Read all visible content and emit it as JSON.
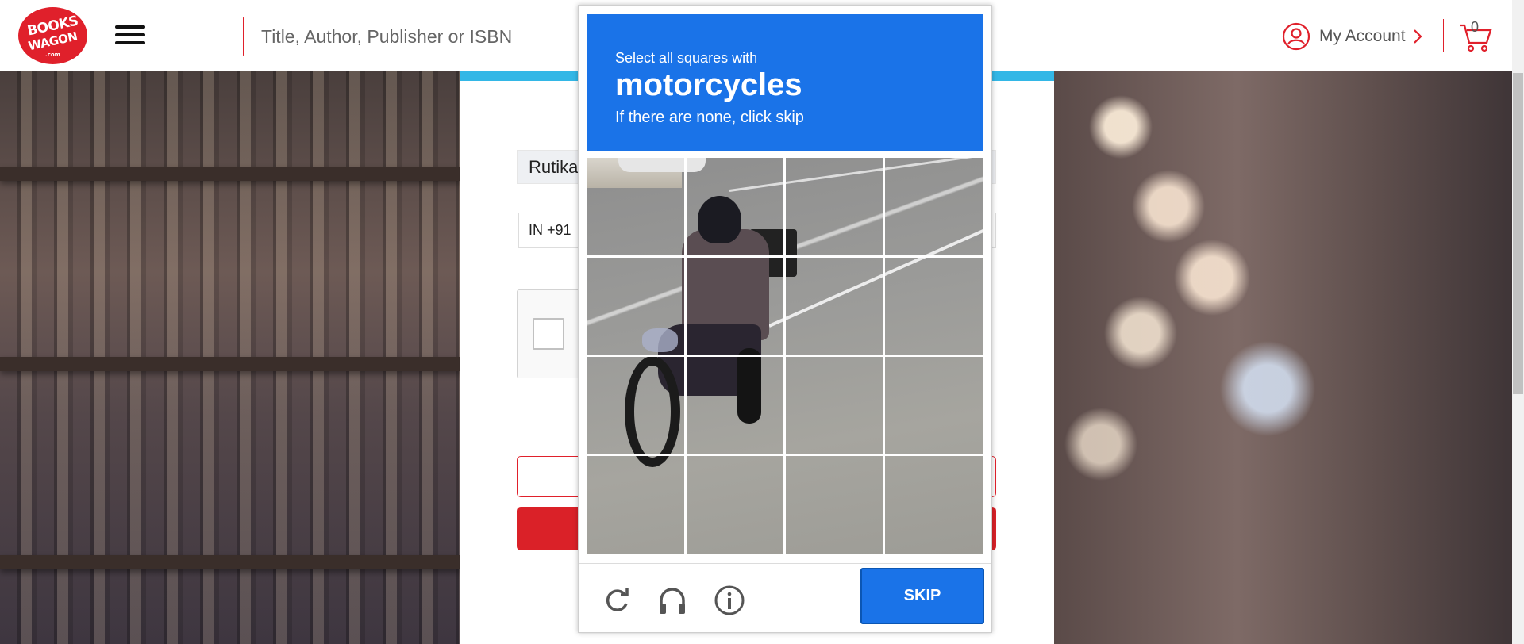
{
  "header": {
    "logo": {
      "line1": "BOOKS",
      "line2": "WAGON",
      "line3": ".com"
    },
    "search": {
      "placeholder": "Title, Author, Publisher or ISBN"
    },
    "account_label": "My Account",
    "cart_count": "0"
  },
  "form": {
    "name_value": "Rutika",
    "country_code": "IN +91"
  },
  "captcha": {
    "instruction": "Select all squares with",
    "target": "motorcycles",
    "sub": "If there are none, click skip",
    "skip_label": "SKIP",
    "grid": {
      "rows": 4,
      "cols": 4
    }
  },
  "colors": {
    "brand_red": "#e0202b",
    "captcha_blue": "#1a73e8",
    "form_topbar": "#33b7e6"
  }
}
